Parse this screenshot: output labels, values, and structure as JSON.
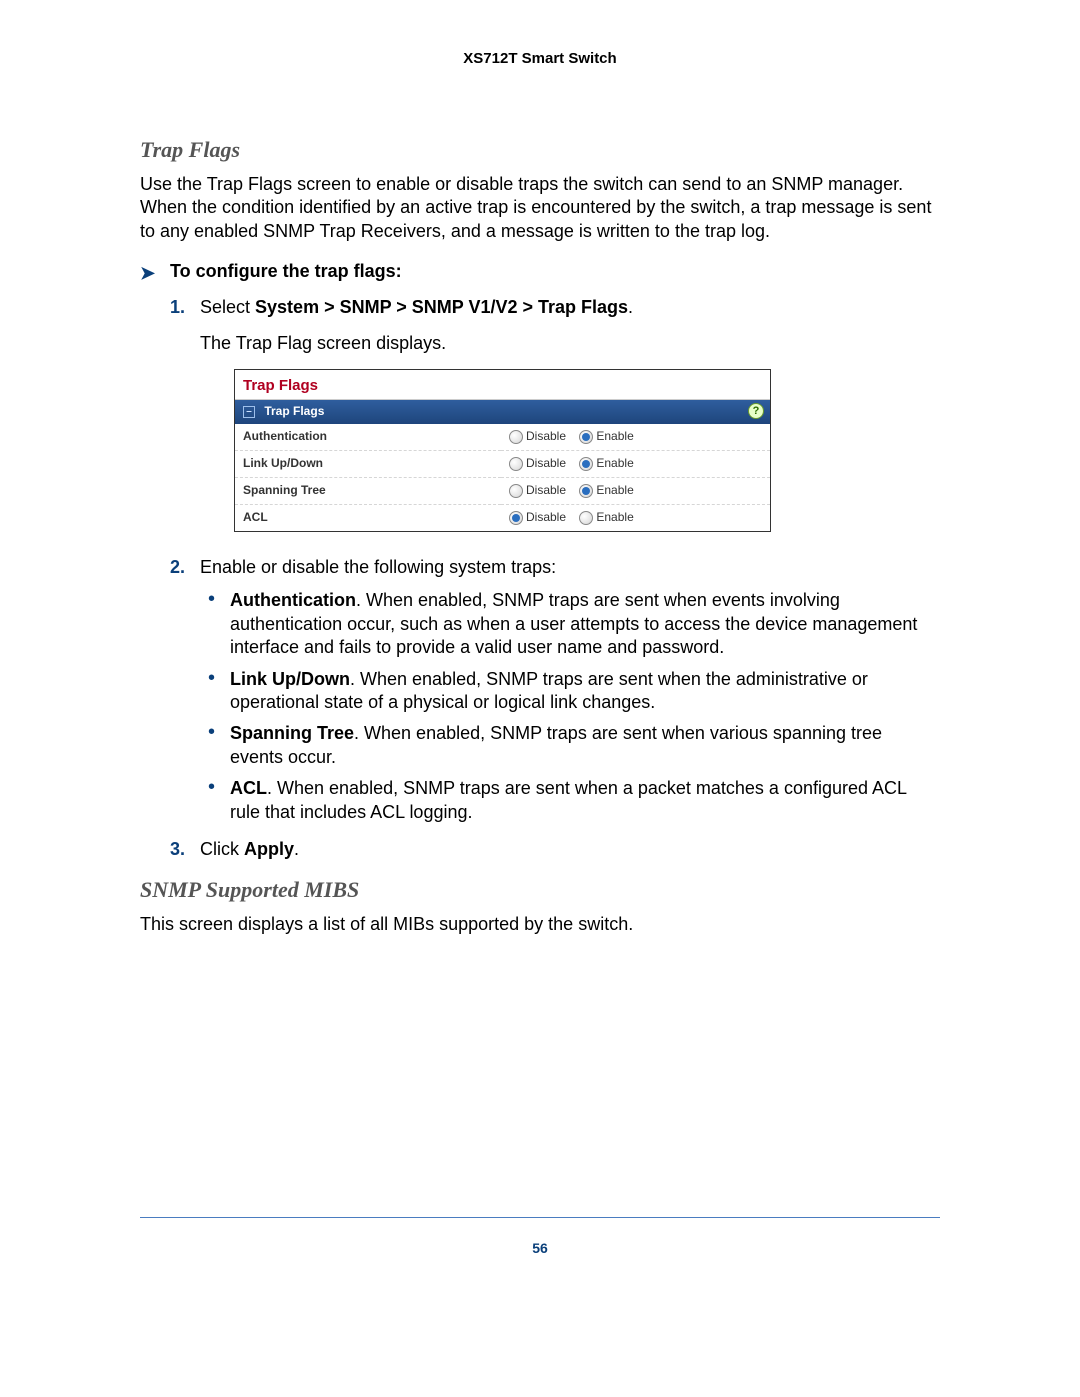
{
  "header": "XS712T Smart Switch",
  "section1": {
    "title": "Trap Flags",
    "intro": "Use the Trap Flags screen to enable or disable traps the switch can send to an SNMP manager. When the condition identified by an active trap is encountered by the switch, a trap message is sent to any enabled SNMP Trap Receivers, and a message is written to the trap log.",
    "proc_heading": "To configure the trap flags:",
    "step1_pre": "Select ",
    "step1_path": "System > SNMP > SNMP V1/V2 > Trap Flags",
    "step1_post": ".",
    "step1_after": "The Trap Flag screen displays.",
    "panel": {
      "title": "Trap Flags",
      "subtitle": "Trap Flags",
      "help": "?",
      "disable": "Disable",
      "enable": "Enable",
      "rows": [
        {
          "label": "Authentication",
          "selected": "enable"
        },
        {
          "label": "Link Up/Down",
          "selected": "enable"
        },
        {
          "label": "Spanning Tree",
          "selected": "enable"
        },
        {
          "label": "ACL",
          "selected": "disable"
        }
      ]
    },
    "step2": "Enable or disable the following system traps:",
    "bullets": [
      {
        "term": "Authentication",
        "text": ". When enabled, SNMP traps are sent when events involving authentication occur, such as when a user attempts to access the device management interface and fails to provide a valid user name and password."
      },
      {
        "term": "Link Up/Down",
        "text": ". When enabled, SNMP traps are sent when the administrative or operational state of a physical or logical link changes."
      },
      {
        "term": "Spanning Tree",
        "text": ". When enabled, SNMP traps are sent when various spanning tree events occur."
      },
      {
        "term": "ACL",
        "text": ". When enabled, SNMP traps are sent when a packet matches a configured ACL rule that includes ACL logging."
      }
    ],
    "step3_pre": "Click ",
    "step3_bold": "Apply",
    "step3_post": "."
  },
  "section2": {
    "title": "SNMP Supported MIBS",
    "text": "This screen displays a list of all MIBs supported by the switch."
  },
  "page_number": "56"
}
